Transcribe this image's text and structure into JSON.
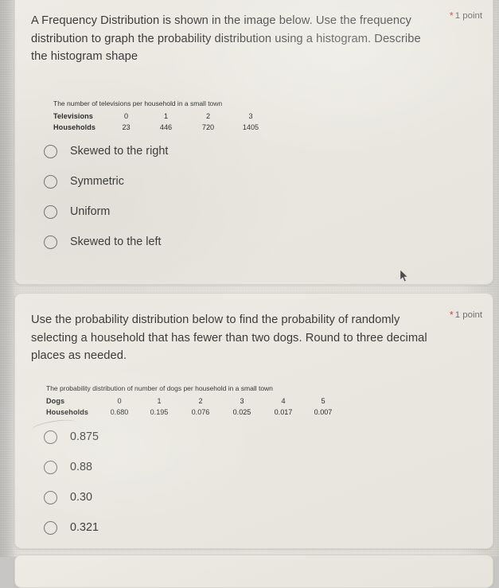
{
  "theme": {
    "card_bg": "#e9e7df",
    "page_bg": "#c7c6c4",
    "text_color": "#3b3b3c",
    "asterisk_color": "#cf4a48",
    "radio_border": "#77777a"
  },
  "questions": [
    {
      "id": "q1",
      "text": "A Frequency Distribution is shown in the image below. Use the frequency distribution to graph the probability distribution using a histogram. Describe the histogram shape",
      "required_marker": "*",
      "points": "1 point",
      "table": {
        "caption": "The number of televisions per household in a small town",
        "rows": [
          {
            "label": "Televisions",
            "values": [
              "0",
              "1",
              "2",
              "3"
            ]
          },
          {
            "label": "Households",
            "values": [
              "23",
              "446",
              "720",
              "1405"
            ]
          }
        ]
      },
      "options": [
        "Skewed to the right",
        "Symmetric",
        "Uniform",
        "Skewed to the left"
      ]
    },
    {
      "id": "q2",
      "text": "Use the probability distribution below to find the probability of randomly selecting a household that has fewer than two dogs. Round to three decimal places as needed.",
      "required_marker": "*",
      "points": "1 point",
      "table": {
        "caption": "The probability distribution of number of dogs per household in a small town",
        "rows": [
          {
            "label": "Dogs",
            "values": [
              "0",
              "1",
              "2",
              "3",
              "4",
              "5"
            ]
          },
          {
            "label": "Households",
            "values": [
              "0.680",
              "0.195",
              "0.076",
              "0.025",
              "0.017",
              "0.007"
            ]
          }
        ]
      },
      "options": [
        "0.875",
        "0.88",
        "0.30",
        "0.321"
      ]
    }
  ],
  "cursor": {
    "name": "mouse-pointer"
  }
}
